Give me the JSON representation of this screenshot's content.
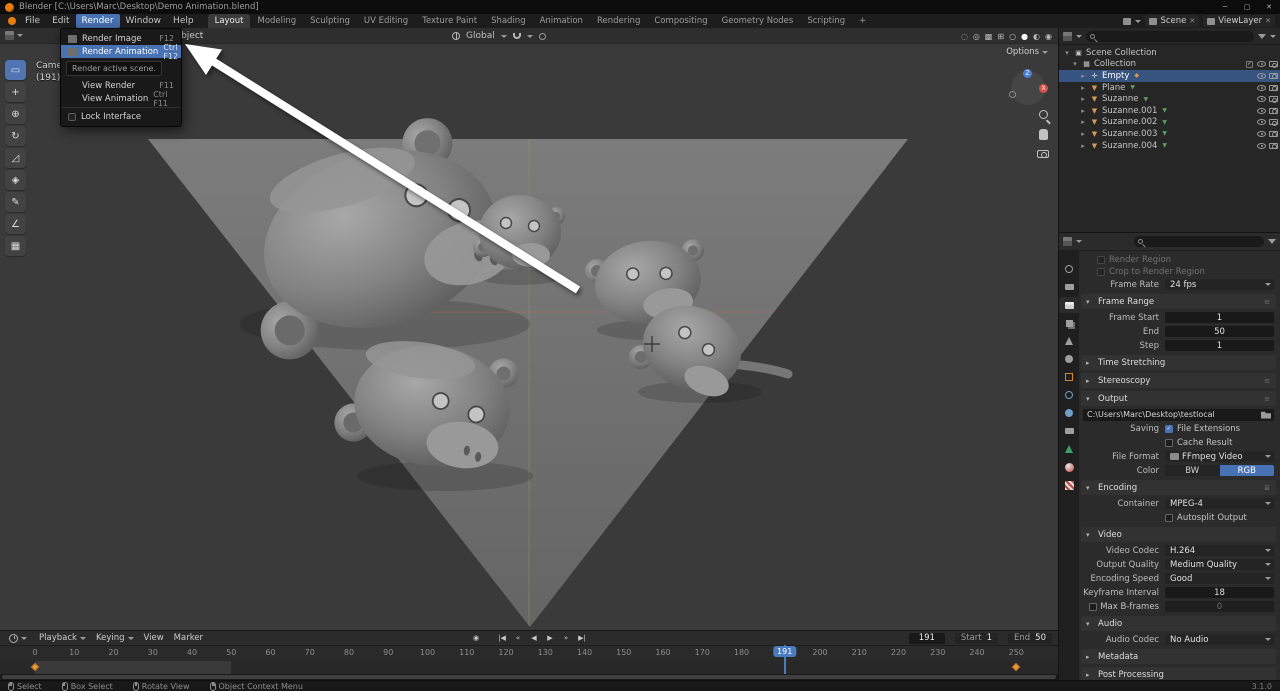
{
  "window": {
    "title": "Blender [C:\\Users\\Marc\\Desktop\\Demo Animation.blend]"
  },
  "menubar": {
    "menus": [
      "File",
      "Edit",
      "Render",
      "Window",
      "Help"
    ],
    "active_menu_index": 2,
    "workspaces": [
      "Layout",
      "Modeling",
      "Sculpting",
      "UV Editing",
      "Texture Paint",
      "Shading",
      "Animation",
      "Rendering",
      "Compositing",
      "Geometry Nodes",
      "Scripting",
      "+"
    ],
    "active_workspace_index": 0,
    "scene_selector": {
      "label": "Scene"
    },
    "viewlayer_selector": {
      "label": "ViewLayer"
    }
  },
  "render_menu": {
    "items_top": [
      {
        "label": "Render Image",
        "shortcut": "F12",
        "highlighted": false
      },
      {
        "label": "Render Animation",
        "shortcut": "Ctrl F12",
        "highlighted": true
      }
    ],
    "tooltip": "Render active scene.",
    "items_bottom": [
      {
        "label": "View Render",
        "shortcut": "F11",
        "checkbox": false
      },
      {
        "label": "View Animation",
        "shortcut": "Ctrl F11",
        "checkbox": false
      },
      {
        "label": "Lock Interface",
        "shortcut": "",
        "checkbox": true
      }
    ]
  },
  "viewport": {
    "header": {
      "object_menu": "Object",
      "orientation": "Global",
      "options_label": "Options",
      "right_icons": [
        "visibility",
        "overlays",
        "xray",
        "gizmos",
        "shading-wireframe",
        "shading-solid",
        "shading-material",
        "shading-rendered"
      ],
      "active_shading": "shading-solid"
    },
    "overlay": {
      "view_label": "Camera Perspective",
      "frame_label": "(191)"
    },
    "tools": [
      "select-box",
      "cursor",
      "move",
      "rotate",
      "scale",
      "transform",
      "annotate",
      "measure",
      "add-cube"
    ]
  },
  "outliner": {
    "root_label": "Scene Collection",
    "collection_label": "Collection",
    "objects": [
      {
        "name": "Empty",
        "type": "empty",
        "selected": true
      },
      {
        "name": "Plane",
        "type": "mesh",
        "selected": false
      },
      {
        "name": "Suzanne",
        "type": "mesh",
        "selected": false
      },
      {
        "name": "Suzanne.001",
        "type": "mesh",
        "selected": false
      },
      {
        "name": "Suzanne.002",
        "type": "mesh",
        "selected": false
      },
      {
        "name": "Suzanne.003",
        "type": "mesh",
        "selected": false
      },
      {
        "name": "Suzanne.004",
        "type": "mesh",
        "selected": false
      }
    ]
  },
  "properties": {
    "tabs": [
      "tool",
      "render",
      "output",
      "view-layer",
      "scene",
      "world",
      "object",
      "modifiers",
      "physics",
      "constraints",
      "object-data",
      "material",
      "texture"
    ],
    "active_tab": "output",
    "rows": [
      {
        "kind": "faded",
        "label": "Render Region"
      },
      {
        "kind": "faded",
        "label": "Crop to Render Region"
      },
      {
        "kind": "dropdown",
        "label": "Frame Rate",
        "value": "24 fps"
      },
      {
        "kind": "header",
        "label": "Frame Range",
        "expanded": true,
        "grip": true
      },
      {
        "kind": "number",
        "label": "Frame Start",
        "value": "1"
      },
      {
        "kind": "number",
        "label": "End",
        "value": "50"
      },
      {
        "kind": "number",
        "label": "Step",
        "value": "1"
      },
      {
        "kind": "header",
        "label": "Time Stretching",
        "expanded": false
      },
      {
        "kind": "header",
        "label": "Stereoscopy",
        "expanded": false,
        "grip": true
      },
      {
        "kind": "header",
        "label": "Output",
        "expanded": true,
        "grip": true
      },
      {
        "kind": "path",
        "value": "C:\\Users\\Marc\\Desktop\\testlocal"
      },
      {
        "kind": "check",
        "label": "Saving",
        "check_label": "File Extensions",
        "checked": true
      },
      {
        "kind": "check",
        "label": "",
        "check_label": "Cache Result",
        "checked": false
      },
      {
        "kind": "dropdown",
        "label": "File Format",
        "value": "FFmpeg Video",
        "icon": "film"
      },
      {
        "kind": "segment",
        "label": "Color",
        "options": [
          "BW",
          "RGB"
        ],
        "active_index": 1
      },
      {
        "kind": "header",
        "label": "Encoding",
        "expanded": true,
        "preset": true
      },
      {
        "kind": "dropdown",
        "label": "Container",
        "value": "MPEG-4"
      },
      {
        "kind": "check",
        "label": "",
        "check_label": "Autosplit Output",
        "checked": false
      },
      {
        "kind": "header",
        "label": "Video",
        "expanded": true
      },
      {
        "kind": "dropdown",
        "label": "Video Codec",
        "value": "H.264"
      },
      {
        "kind": "dropdown",
        "label": "Output Quality",
        "value": "Medium Quality"
      },
      {
        "kind": "dropdown",
        "label": "Encoding Speed",
        "value": "Good"
      },
      {
        "kind": "number",
        "label": "Keyframe Interval",
        "value": "18"
      },
      {
        "kind": "numbercheck",
        "label": "Max B-frames",
        "value": "0",
        "checked": false
      },
      {
        "kind": "header",
        "label": "Audio",
        "expanded": true
      },
      {
        "kind": "dropdown",
        "label": "Audio Codec",
        "value": "No Audio"
      },
      {
        "kind": "header",
        "label": "Metadata",
        "expanded": false
      },
      {
        "kind": "header",
        "label": "Post Processing",
        "expanded": false
      }
    ]
  },
  "timeline": {
    "menus": [
      "Playback",
      "Keying",
      "View",
      "Marker"
    ],
    "ruler_numbers": [
      0,
      10,
      20,
      30,
      40,
      50,
      60,
      70,
      80,
      90,
      100,
      110,
      120,
      130,
      140,
      150,
      160,
      170,
      180,
      190,
      200,
      210,
      220,
      230,
      240,
      250
    ],
    "current_frame": "191",
    "range_start_frame": 0,
    "range_end_frame": 50,
    "start": {
      "label": "Start",
      "value": "1"
    },
    "end": {
      "label": "End",
      "value": "50"
    },
    "keyframe_frames": [
      0,
      250
    ]
  },
  "statusbar": {
    "hints": [
      {
        "icon": "mouse-left",
        "label": "Select"
      },
      {
        "icon": "mouse-left",
        "label": "Box Select"
      },
      {
        "icon": "mouse-middle",
        "label": "Rotate View"
      },
      {
        "icon": "mouse-right",
        "label": "Object Context Menu"
      }
    ],
    "version": "3.1.0"
  },
  "colors": {
    "accent": "#4772b3",
    "selected_row": "#36547f",
    "keyframe": "#e8983a"
  }
}
